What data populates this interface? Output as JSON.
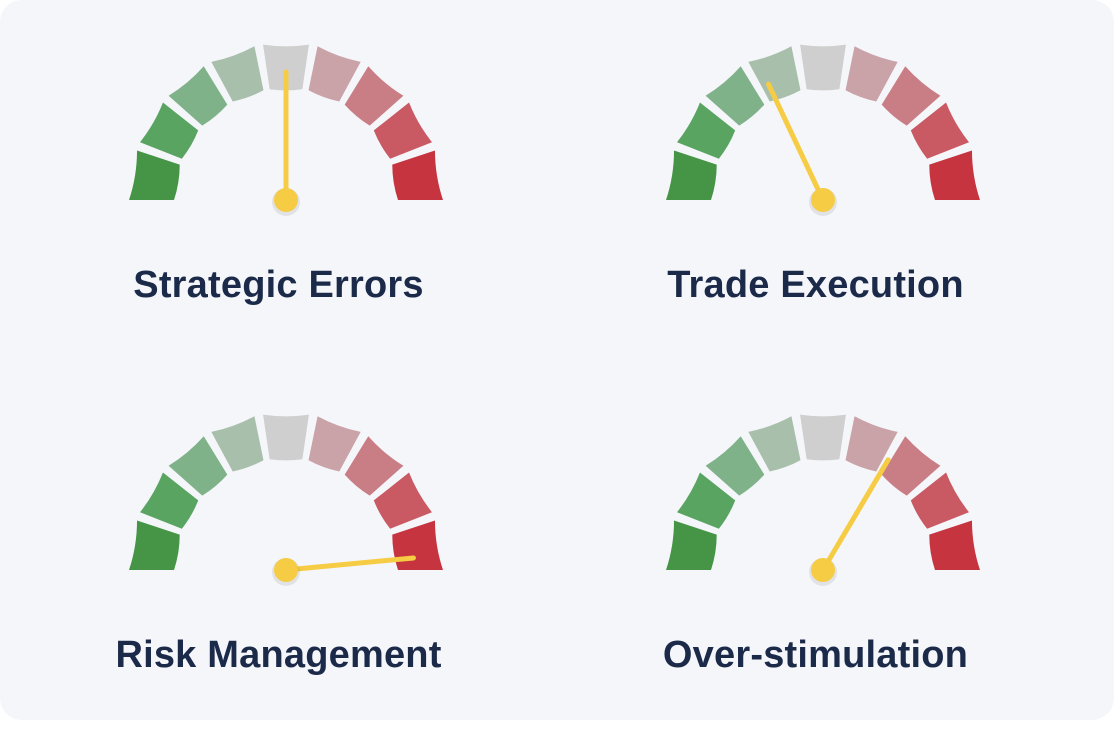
{
  "segment_colors": [
    "#469547",
    "#5aa462",
    "#80b28a",
    "#a8bfac",
    "#cfcfcf",
    "#c9a3a8",
    "#c97d85",
    "#c95a64",
    "#c6343f"
  ],
  "needle_color": "#f6cc45",
  "label_color": "#1c2a4a",
  "chart_data": [
    {
      "type": "gauge",
      "title": "Strategic Errors",
      "min": 0,
      "max": 1,
      "value": 0.5
    },
    {
      "type": "gauge",
      "title": "Trade Execution",
      "min": 0,
      "max": 1,
      "value": 0.36
    },
    {
      "type": "gauge",
      "title": "Risk Management",
      "min": 0,
      "max": 1,
      "value": 0.97
    },
    {
      "type": "gauge",
      "title": "Over-stimulation",
      "min": 0,
      "max": 1,
      "value": 0.67
    }
  ]
}
